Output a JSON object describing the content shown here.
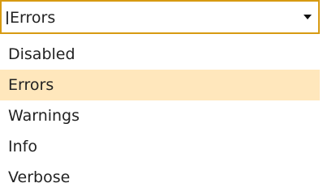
{
  "dropdown": {
    "selected_value": "Errors",
    "options": [
      {
        "label": "Disabled",
        "selected": false
      },
      {
        "label": "Errors",
        "selected": true
      },
      {
        "label": "Warnings",
        "selected": false
      },
      {
        "label": "Info",
        "selected": false
      },
      {
        "label": "Verbose",
        "selected": false
      }
    ],
    "colors": {
      "border": "#d79a12",
      "selected_bg": "#ffe7bc",
      "text": "#222222"
    },
    "caret_icon": "chevron-down-icon"
  }
}
